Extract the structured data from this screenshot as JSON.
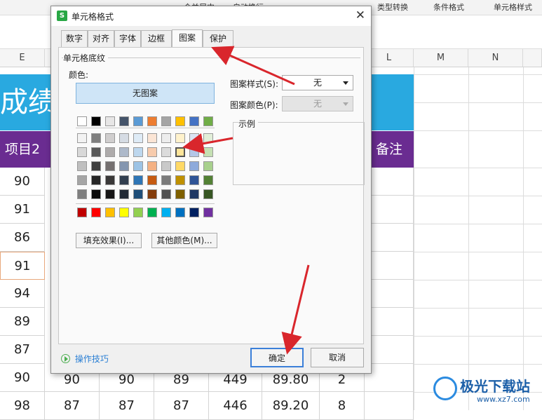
{
  "toolbar": {
    "items": [
      "合并居中",
      "自动换行",
      "类型转换",
      "条件格式",
      "单元格样式"
    ]
  },
  "sheet": {
    "columns": [
      "E",
      "L",
      "M",
      "N"
    ],
    "title_text": "成绩",
    "header_left": "项目2",
    "header_right": "备注",
    "col_e_values": [
      "90",
      "91",
      "86",
      "91",
      "94",
      "89",
      "87",
      "90",
      "98"
    ],
    "row_8": [
      "90",
      "90",
      "89",
      "449",
      "89.80",
      "2"
    ],
    "row_9": [
      "87",
      "87",
      "87",
      "446",
      "89.20",
      "8"
    ]
  },
  "dialog": {
    "title": "单元格格式",
    "close_glyph": "✕",
    "logo_letter": "S",
    "tabs": [
      "数字",
      "对齐",
      "字体",
      "边框",
      "图案",
      "保护"
    ],
    "active_tab": "图案",
    "group_label": "单元格底纹",
    "color_label": "颜色:",
    "no_pattern_label": "无图案",
    "fill_effect_button": "填充效果(I)...",
    "more_colors_button": "其他颜色(M)...",
    "pattern_style_label": "图案样式(S):",
    "pattern_style_value": "无",
    "pattern_color_label": "图案颜色(P):",
    "pattern_color_value": "无",
    "sample_label": "示例",
    "tips_link": "操作技巧",
    "ok_button": "确定",
    "cancel_button": "取消"
  },
  "palette": {
    "top_row": [
      "#ffffff",
      "#000000",
      "#e7e6e6",
      "#44546a",
      "#5b9bd5",
      "#ed7d31",
      "#a5a5a5",
      "#ffc000",
      "#4472c4",
      "#70ad47"
    ],
    "tint_rows": [
      [
        "#f2f2f2",
        "#7f7f7f",
        "#d0cece",
        "#d6dce4",
        "#deebf6",
        "#fbe5d5",
        "#ededed",
        "#fff2cc",
        "#dae3f3",
        "#e2efd9"
      ],
      [
        "#d8d8d8",
        "#595959",
        "#aeabab",
        "#adb9ca",
        "#bdd7ee",
        "#f7cbac",
        "#dbdbdb",
        "#fee599",
        "#b4c6e7",
        "#c5e0b3"
      ],
      [
        "#bfbfbf",
        "#3f3f3f",
        "#757070",
        "#8496b0",
        "#9cc3e5",
        "#f4b183",
        "#c9c9c9",
        "#ffd965",
        "#8eaadb",
        "#a8d08d"
      ],
      [
        "#a5a5a5",
        "#262626",
        "#3a3838",
        "#323f4f",
        "#2e75b5",
        "#c55a11",
        "#7b7b7b",
        "#bf9000",
        "#2f5496",
        "#538135"
      ],
      [
        "#7f7f7f",
        "#0c0c0c",
        "#171616",
        "#222a35",
        "#1e4e79",
        "#833c0b",
        "#525252",
        "#7f6000",
        "#1f3864",
        "#375623"
      ]
    ],
    "standard_row": [
      "#c00000",
      "#ff0000",
      "#ffc000",
      "#ffff00",
      "#92d050",
      "#00b050",
      "#00b0f0",
      "#0070c0",
      "#002060",
      "#7030a0"
    ],
    "accent_blue": "#29a9e0",
    "header_purple": "#6a2c91",
    "arrow_red": "#d9262c"
  },
  "watermark": {
    "brand": "极光下载站",
    "url": "www.xz7.com"
  }
}
